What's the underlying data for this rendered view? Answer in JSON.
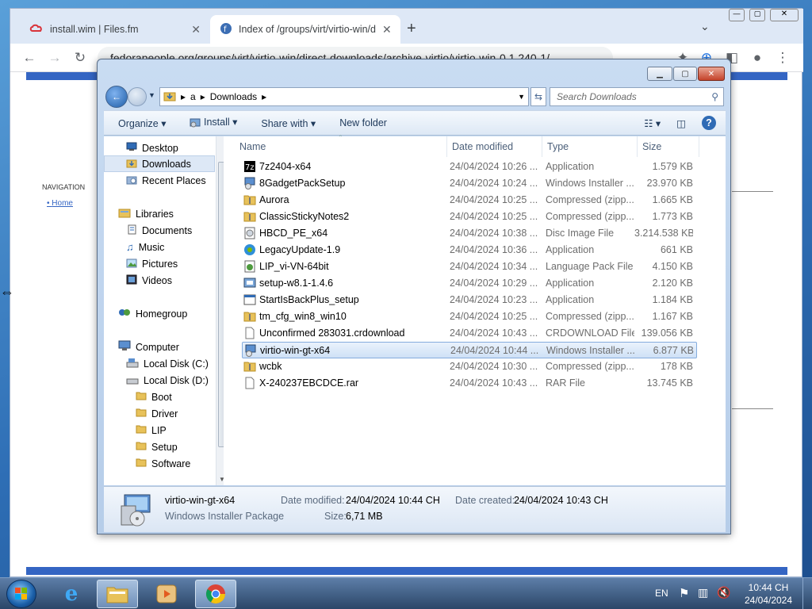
{
  "chrome": {
    "tabs": [
      {
        "title": "install.wim | Files.fm",
        "close": "✕"
      },
      {
        "title": "Index of /groups/virt/virtio-win/d",
        "close": "✕"
      }
    ],
    "new_tab": "+",
    "url": "fedorapeople.org/groups/virt/virtio-win/direct-downloads/archive-virtio/virtio-win-0.1.240-1/",
    "window_controls": {
      "minimize": "—",
      "maximize": "▢",
      "close": "✕"
    },
    "page": {
      "nav_heading": "NAVIGATION",
      "nav_home": "Home"
    }
  },
  "explorer": {
    "breadcrumb": [
      "a",
      "Downloads"
    ],
    "search_placeholder": "Search Downloads",
    "toolbar": {
      "organize": "Organize",
      "install": "Install",
      "share_with": "Share with",
      "new_folder": "New folder"
    },
    "nav": {
      "favorites": [
        {
          "label": "Desktop",
          "icon": "desktop-icon",
          "selected": false
        },
        {
          "label": "Downloads",
          "icon": "downloads-icon",
          "selected": true
        },
        {
          "label": "Recent Places",
          "icon": "recent-places-icon",
          "selected": false
        }
      ],
      "libraries_label": "Libraries",
      "libraries": [
        {
          "label": "Documents",
          "icon": "documents-icon"
        },
        {
          "label": "Music",
          "icon": "music-icon"
        },
        {
          "label": "Pictures",
          "icon": "pictures-icon"
        },
        {
          "label": "Videos",
          "icon": "videos-icon"
        }
      ],
      "homegroup_label": "Homegroup",
      "computer_label": "Computer",
      "drives": [
        {
          "label": "Local Disk (C:)",
          "icon": "drive-icon"
        },
        {
          "label": "Local Disk (D:)",
          "icon": "drive-icon"
        }
      ],
      "folders": [
        "Boot",
        "Driver",
        "LIP",
        "Setup",
        "Software"
      ]
    },
    "columns": {
      "name": "Name",
      "date": "Date modified",
      "type": "Type",
      "size": "Size"
    },
    "files": [
      {
        "name": "7z2404-x64",
        "date": "24/04/2024 10:26 ...",
        "type": "Application",
        "size": "1.579 KB",
        "icon": "7zip-app-icon"
      },
      {
        "name": "8GadgetPackSetup",
        "date": "24/04/2024 10:24 ...",
        "type": "Windows Installer ...",
        "size": "23.970 KB",
        "icon": "installer-icon"
      },
      {
        "name": "Aurora",
        "date": "24/04/2024 10:25 ...",
        "type": "Compressed (zipp...",
        "size": "1.665 KB",
        "icon": "zip-folder-icon"
      },
      {
        "name": "ClassicStickyNotes2",
        "date": "24/04/2024 10:25 ...",
        "type": "Compressed (zipp...",
        "size": "1.773 KB",
        "icon": "zip-folder-icon"
      },
      {
        "name": "HBCD_PE_x64",
        "date": "24/04/2024 10:38 ...",
        "type": "Disc Image File",
        "size": "3.214.538 KB",
        "icon": "disc-image-icon"
      },
      {
        "name": "LegacyUpdate-1.9",
        "date": "24/04/2024 10:36 ...",
        "type": "Application",
        "size": "661 KB",
        "icon": "legacy-update-icon"
      },
      {
        "name": "LIP_vi-VN-64bit",
        "date": "24/04/2024 10:34 ...",
        "type": "Language Pack File",
        "size": "4.150 KB",
        "icon": "language-pack-icon"
      },
      {
        "name": "setup-w8.1-1.4.6",
        "date": "24/04/2024 10:29 ...",
        "type": "Application",
        "size": "2.120 KB",
        "icon": "setup-app-icon"
      },
      {
        "name": "StartIsBackPlus_setup",
        "date": "24/04/2024 10:23 ...",
        "type": "Application",
        "size": "1.184 KB",
        "icon": "app-icon"
      },
      {
        "name": "tm_cfg_win8_win10",
        "date": "24/04/2024 10:25 ...",
        "type": "Compressed (zipp...",
        "size": "1.167 KB",
        "icon": "zip-folder-icon"
      },
      {
        "name": "Unconfirmed 283031.crdownload",
        "date": "24/04/2024 10:43 ...",
        "type": "CRDOWNLOAD File",
        "size": "139.056 KB",
        "icon": "file-icon"
      },
      {
        "name": "virtio-win-gt-x64",
        "date": "24/04/2024 10:44 ...",
        "type": "Windows Installer ...",
        "size": "6.877 KB",
        "icon": "installer-icon",
        "selected": true
      },
      {
        "name": "wcbk",
        "date": "24/04/2024 10:30 ...",
        "type": "Compressed (zipp...",
        "size": "178 KB",
        "icon": "zip-folder-icon"
      },
      {
        "name": "X-240237EBCDCE.rar",
        "date": "24/04/2024 10:43 ...",
        "type": "RAR File",
        "size": "13.745 KB",
        "icon": "file-icon"
      }
    ],
    "details": {
      "name": "virtio-win-gt-x64",
      "type": "Windows Installer Package",
      "date_modified_label": "Date modified:",
      "date_modified": "24/04/2024 10:44 CH",
      "date_created_label": "Date created:",
      "date_created": "24/04/2024 10:43 CH",
      "size_label": "Size:",
      "size": "6,71 MB"
    }
  },
  "taskbar": {
    "language": "EN",
    "time": "10:44 CH",
    "date": "24/04/2024"
  },
  "colors": {
    "selection": "#cfe1f6",
    "selection_border": "#84acdd",
    "taskbar": "#2b4668",
    "web_accent": "#3465c3"
  }
}
